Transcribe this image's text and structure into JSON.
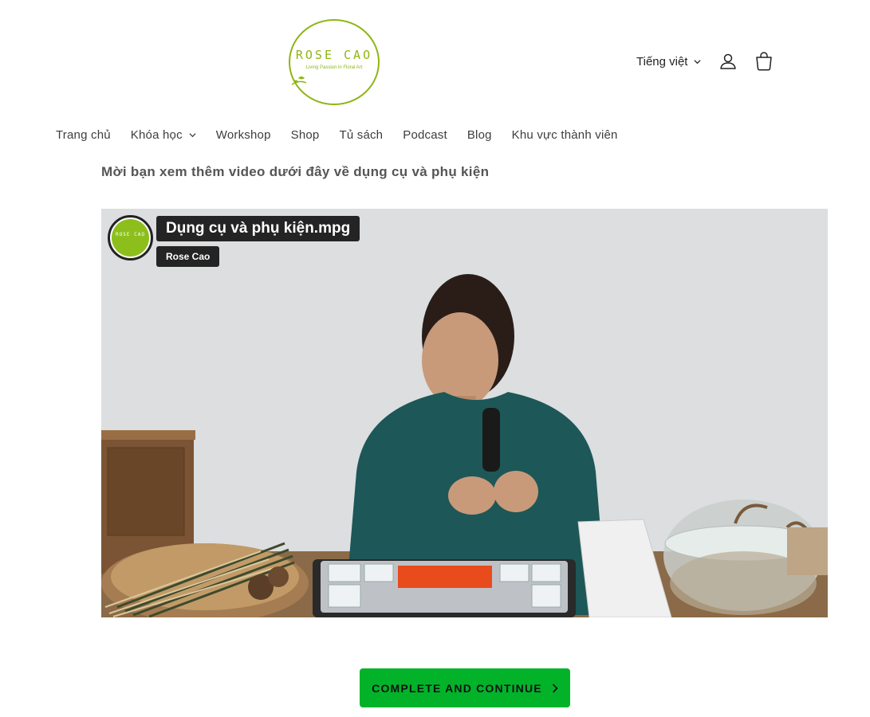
{
  "header": {
    "logo_text": "ROSE CAO",
    "logo_tagline": "Living Passion in Floral Art",
    "language": "Tiếng việt",
    "brand_color": "#8fb513"
  },
  "nav": {
    "items": [
      {
        "label": "Trang chủ",
        "has_dropdown": false
      },
      {
        "label": "Khóa học",
        "has_dropdown": true
      },
      {
        "label": "Workshop",
        "has_dropdown": false
      },
      {
        "label": "Shop",
        "has_dropdown": false
      },
      {
        "label": "Tủ sách",
        "has_dropdown": false
      },
      {
        "label": "Podcast",
        "has_dropdown": false
      },
      {
        "label": "Blog",
        "has_dropdown": false
      },
      {
        "label": "Khu vực thành viên",
        "has_dropdown": false
      }
    ]
  },
  "content": {
    "intro": "Mời bạn xem thêm video dưới đây về dụng cụ và phụ kiện"
  },
  "video": {
    "title": "Dụng cụ và phụ kiện.mpg",
    "channel": "Rose Cao",
    "channel_avatar_text": "ROSE CAO"
  },
  "cta": {
    "label": "COMPLETE AND CONTINUE",
    "color": "#02b32a"
  },
  "icons": [
    "chevron-down-icon",
    "user-icon",
    "cart-icon",
    "chevron-right-icon"
  ]
}
